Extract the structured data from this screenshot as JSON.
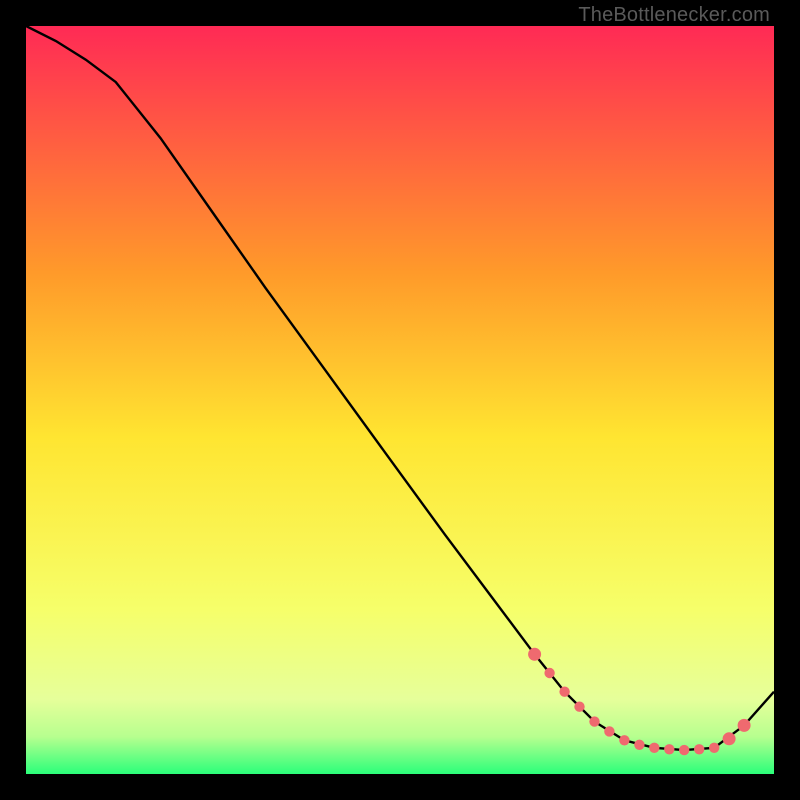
{
  "watermark": "TheBottlenecker.com",
  "colors": {
    "top": "#ff2a55",
    "mid_upper": "#ff9a2a",
    "mid": "#ffe531",
    "mid_lower": "#f6ff6a",
    "green_light": "#b7ff8f",
    "green": "#2bff7a",
    "curve": "#000000",
    "marker": "#ef6a6f",
    "background": "#000000"
  },
  "chart_data": {
    "type": "line",
    "title": "",
    "xlabel": "",
    "ylabel": "",
    "xlim": [
      0,
      100
    ],
    "ylim": [
      0,
      100
    ],
    "series": [
      {
        "name": "bottleneck-curve",
        "x": [
          0,
          4,
          8,
          12,
          18,
          25,
          32,
          40,
          48,
          56,
          62,
          68,
          72,
          76,
          80,
          84,
          88,
          92,
          96,
          100
        ],
        "y": [
          100,
          98,
          95.5,
          92.5,
          85,
          75,
          65,
          54,
          43,
          32,
          24,
          16,
          11,
          7,
          4.5,
          3.5,
          3.2,
          3.5,
          6.5,
          11
        ]
      }
    ],
    "markers": {
      "name": "highlight-segment",
      "x": [
        68,
        70,
        72,
        74,
        76,
        78,
        80,
        82,
        84,
        86,
        88,
        90,
        92,
        94,
        96
      ],
      "y": [
        16,
        13.5,
        11,
        9,
        7,
        5.7,
        4.5,
        3.9,
        3.5,
        3.3,
        3.2,
        3.3,
        3.5,
        4.7,
        6.5
      ]
    }
  }
}
